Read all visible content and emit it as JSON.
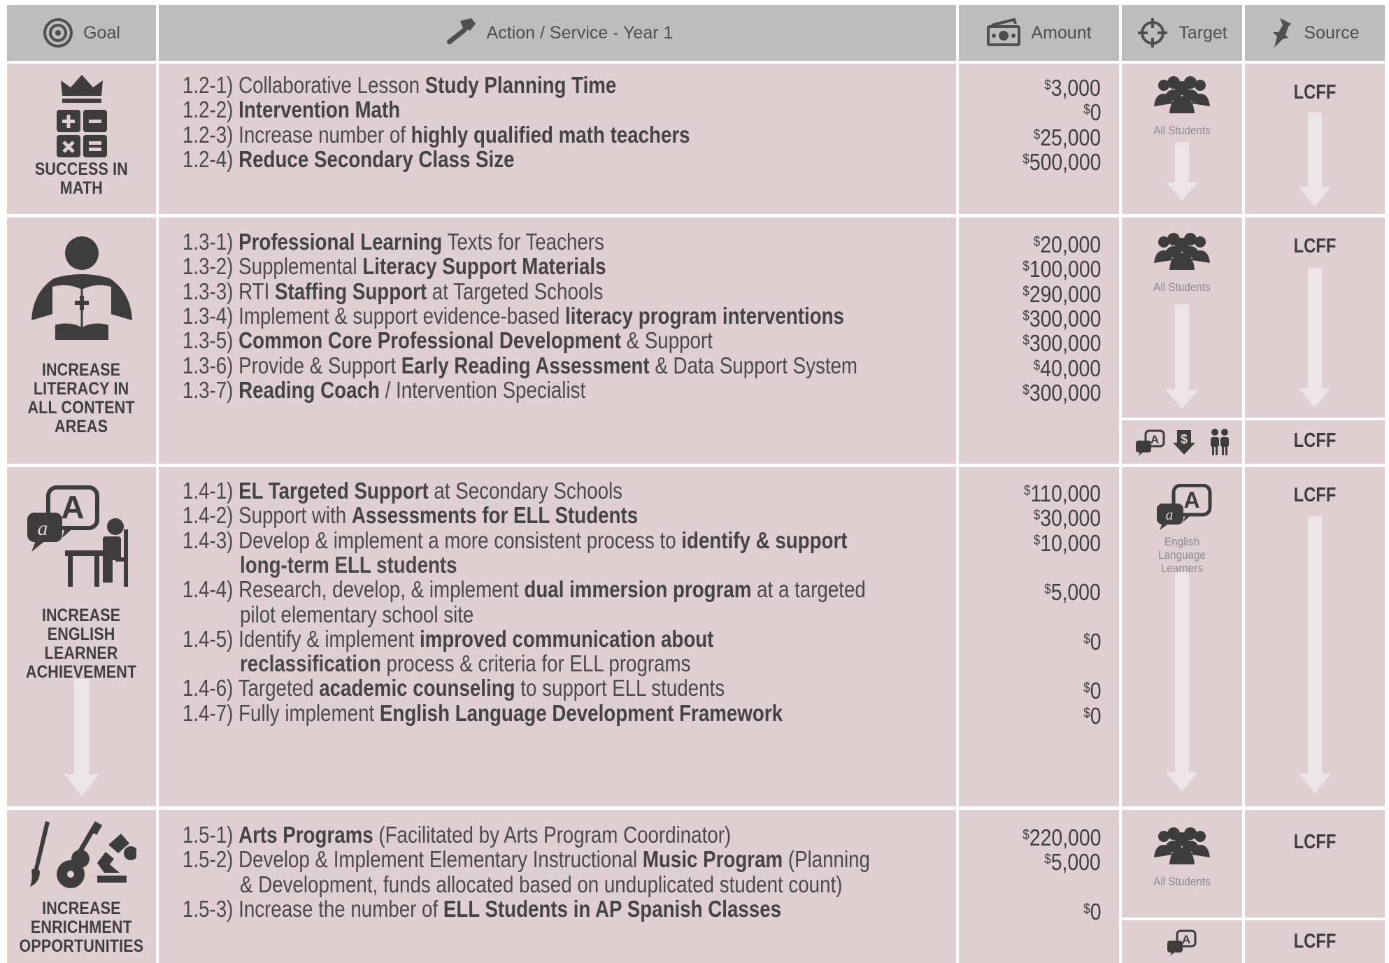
{
  "header": {
    "goal": "Goal",
    "action": "Action / Service - Year 1",
    "amount": "Amount",
    "target": "Target",
    "source": "Source"
  },
  "colors": {
    "header_bg": "#bcbdbf",
    "cell_bg": "#dfcfd0",
    "text": "#4a4a4a",
    "arrow": "#ece6e6"
  },
  "icons": [
    "target-icon",
    "hammer-icon",
    "money-icon",
    "crosshair-icon",
    "pushpin-icon",
    "crown-math-icon",
    "reader-icon",
    "ell-icon",
    "arts-icon",
    "group-icon"
  ],
  "goals": [
    {
      "label": [
        "SUCCESS IN",
        "MATH"
      ],
      "actions": [
        {
          "num": "1.2-1)",
          "parts": [
            [
              "Collaborative Lesson ",
              false
            ],
            [
              "Study Planning Time",
              true
            ]
          ],
          "amount": "3,000"
        },
        {
          "num": "1.2-2)",
          "parts": [
            [
              "Intervention Math",
              true
            ]
          ],
          "amount": "0"
        },
        {
          "num": "1.2-3)",
          "parts": [
            [
              "Increase number of ",
              false
            ],
            [
              "highly qualified math teachers",
              true
            ]
          ],
          "amount": "25,000"
        },
        {
          "num": "1.2-4)",
          "parts": [
            [
              "Reduce Secondary Class Size",
              true
            ]
          ],
          "amount": "500,000"
        }
      ],
      "target": "All Students",
      "source": "LCFF"
    },
    {
      "label": [
        "INCREASE",
        "LITERACY IN",
        "ALL CONTENT",
        "AREAS"
      ],
      "actions": [
        {
          "num": "1.3-1)",
          "parts": [
            [
              "Professional Learning",
              true
            ],
            [
              " Texts for Teachers",
              false
            ]
          ],
          "amount": "20,000"
        },
        {
          "num": "1.3-2)",
          "parts": [
            [
              "Supplemental ",
              false
            ],
            [
              "Literacy Support Materials",
              true
            ]
          ],
          "amount": "100,000"
        },
        {
          "num": "1.3-3)",
          "parts": [
            [
              "RTI ",
              false
            ],
            [
              "Staffing Support",
              true
            ],
            [
              " at Targeted Schools",
              false
            ]
          ],
          "amount": "290,000"
        },
        {
          "num": "1.3-4)",
          "parts": [
            [
              "Implement & support evidence-based ",
              false
            ],
            [
              "literacy program interventions",
              true
            ]
          ],
          "amount": "300,000"
        },
        {
          "num": "1.3-5)",
          "parts": [
            [
              "Common Core Professional Development",
              true
            ],
            [
              " & Support",
              false
            ]
          ],
          "amount": "300,000"
        },
        {
          "num": "1.3-6)",
          "parts": [
            [
              "Provide & Support ",
              false
            ],
            [
              "Early Reading Assessment",
              true
            ],
            [
              " & Data Support System",
              false
            ]
          ],
          "amount": "40,000"
        },
        {
          "num": "1.3-7)",
          "parts": [
            [
              "Reading Coach",
              true
            ],
            [
              " / Intervention Specialist",
              false
            ]
          ],
          "amount": "300,000"
        }
      ],
      "target": "All Students",
      "source": "LCFF",
      "source2": "LCFF"
    },
    {
      "label": [
        "INCREASE",
        "ENGLISH",
        "LEARNER",
        "ACHIEVEMENT"
      ],
      "actions": [
        {
          "num": "1.4-1)",
          "parts": [
            [
              "EL Targeted Support",
              true
            ],
            [
              " at Secondary Schools",
              false
            ]
          ],
          "amount": "110,000"
        },
        {
          "num": "1.4-2)",
          "parts": [
            [
              "Support with ",
              false
            ],
            [
              "Assessments for ELL Students",
              true
            ]
          ],
          "amount": "30,000"
        },
        {
          "num": "1.4-3)",
          "parts": [
            [
              "Develop & implement a more consistent process to ",
              false
            ],
            [
              "identify & support",
              true
            ]
          ],
          "cont": [
            [
              "long-term ELL students",
              true
            ]
          ],
          "amount": "10,000"
        },
        {
          "num": "1.4-4)",
          "parts": [
            [
              "Research, develop, & implement ",
              false
            ],
            [
              "dual immersion program",
              true
            ],
            [
              " at a targeted",
              false
            ]
          ],
          "cont": [
            [
              "pilot elementary school site",
              false
            ]
          ],
          "amount": "5,000"
        },
        {
          "num": "1.4-5)",
          "parts": [
            [
              "Identify & implement ",
              false
            ],
            [
              "improved communication about",
              true
            ]
          ],
          "cont": [
            [
              "reclassification",
              true
            ],
            [
              " process & criteria for ELL programs",
              false
            ]
          ],
          "amount": "0"
        },
        {
          "num": "1.4-6)",
          "parts": [
            [
              "Targeted ",
              false
            ],
            [
              "academic counseling",
              true
            ],
            [
              " to support ELL students",
              false
            ]
          ],
          "amount": "0"
        },
        {
          "num": "1.4-7)",
          "parts": [
            [
              "Fully implement ",
              false
            ],
            [
              "English Language Development Framework",
              true
            ]
          ],
          "amount": "0"
        }
      ],
      "target": "English Language Learners",
      "source": "LCFF"
    },
    {
      "label": [
        "INCREASE",
        "ENRICHMENT",
        "OPPORTUNITIES"
      ],
      "actions": [
        {
          "num": "1.5-1)",
          "parts": [
            [
              "Arts Programs",
              true
            ],
            [
              " (Facilitated by Arts Program Coordinator)",
              false
            ]
          ],
          "amount": "220,000"
        },
        {
          "num": "1.5-2)",
          "parts": [
            [
              "Develop & Implement Elementary Instructional ",
              false
            ],
            [
              "Music Program",
              true
            ],
            [
              " (Planning",
              false
            ]
          ],
          "cont": [
            [
              "& Development, funds allocated based on unduplicated student count)",
              false
            ]
          ],
          "amount": "5,000"
        },
        {
          "num": "1.5-3)",
          "parts": [
            [
              "Increase the number of ",
              false
            ],
            [
              "ELL Students in AP Spanish Classes",
              true
            ]
          ],
          "amount": "0"
        }
      ],
      "target": "All Students",
      "source": "LCFF",
      "source2": "LCFF"
    }
  ]
}
